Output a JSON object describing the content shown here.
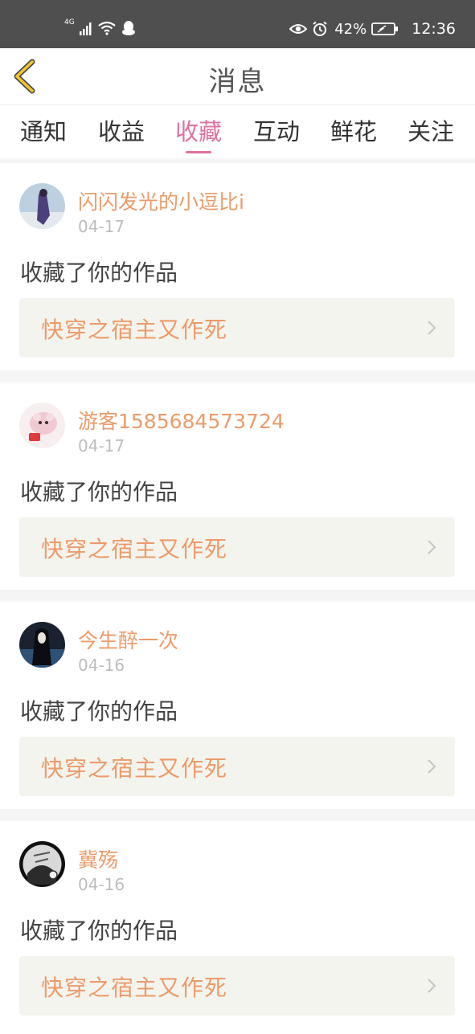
{
  "status_bar": {
    "network": "4G",
    "battery_percent": "42%",
    "time": "12:36"
  },
  "header": {
    "title": "消息"
  },
  "tabs": [
    {
      "label": "通知"
    },
    {
      "label": "收益"
    },
    {
      "label": "收藏",
      "active": true
    },
    {
      "label": "互动"
    },
    {
      "label": "鲜花"
    },
    {
      "label": "关注"
    }
  ],
  "messages": [
    {
      "username": "闪闪发光的小逗比i",
      "date": "04-17",
      "action": "收藏了你的作品",
      "work_title": "快穿之宿主又作死"
    },
    {
      "username": "游客1585684573724",
      "date": "04-17",
      "action": "收藏了你的作品",
      "work_title": "快穿之宿主又作死"
    },
    {
      "username": "今生醉一次",
      "date": "04-16",
      "action": "收藏了你的作品",
      "work_title": "快穿之宿主又作死"
    },
    {
      "username": "冀殇",
      "date": "04-16",
      "action": "收藏了你的作品",
      "work_title": "快穿之宿主又作死"
    }
  ],
  "colors": {
    "accent": "#e0719f",
    "username": "#ec9b6a",
    "status_bar": "#4f4f4f"
  }
}
